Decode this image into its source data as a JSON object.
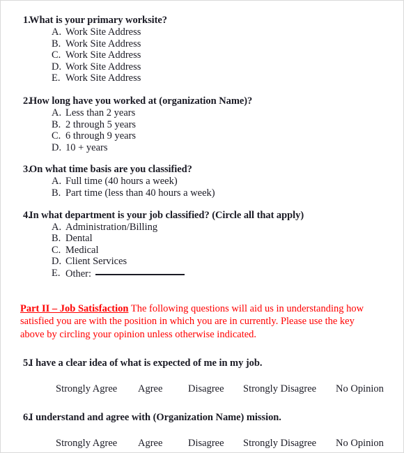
{
  "document": {
    "type": "employee-satisfaction-survey",
    "text_color": "#1a1a24",
    "accent_color": "#ff0000"
  },
  "questions": [
    {
      "number": "1.",
      "text": "What is your primary worksite?",
      "options": [
        {
          "letter": "A.",
          "text": "Work Site Address"
        },
        {
          "letter": "B.",
          "text": "Work Site Address"
        },
        {
          "letter": "C.",
          "text": "Work Site Address"
        },
        {
          "letter": "D.",
          "text": "Work Site Address"
        },
        {
          "letter": "E.",
          "text": "Work Site Address"
        }
      ]
    },
    {
      "number": "2.",
      "text": "How long have you worked at (organization Name)?",
      "options": [
        {
          "letter": "A.",
          "text": "Less than 2 years"
        },
        {
          "letter": "B.",
          "text": "2 through 5 years"
        },
        {
          "letter": "C.",
          "text": "6 through 9 years"
        },
        {
          "letter": "D.",
          "text": "10 + years"
        }
      ]
    },
    {
      "number": "3.",
      "text": "On what time basis are you classified?",
      "options": [
        {
          "letter": "A.",
          "text": "Full time (40 hours a week)"
        },
        {
          "letter": "B.",
          "text": "Part time (less than 40 hours a week)"
        }
      ]
    },
    {
      "number": "4.",
      "text": "In what department is your job classified? (Circle all that apply)",
      "options": [
        {
          "letter": "A.",
          "text": "Administration/Billing"
        },
        {
          "letter": "B.",
          "text": "Dental"
        },
        {
          "letter": "C.",
          "text": "Medical"
        },
        {
          "letter": "D.",
          "text": "Client Services"
        },
        {
          "letter": "E.",
          "text": "Other:",
          "has_blank": true
        }
      ]
    }
  ],
  "part_two": {
    "label": "Part II – Job Satisfaction",
    "intro": " The following questions will aid us in understanding how satisfied you are with the position in which you are in currently. Please use the key above by circling your opinion unless otherwise indicated."
  },
  "likert_scale": [
    "Strongly Agree",
    "Agree",
    "Disagree",
    "Strongly Disagree",
    "No Opinion"
  ],
  "likert_questions": [
    {
      "number": "5.",
      "text": "I have a clear idea of what is expected of me in my job."
    },
    {
      "number": "6.",
      "text": "I understand and agree with (Organization Name) mission."
    }
  ]
}
